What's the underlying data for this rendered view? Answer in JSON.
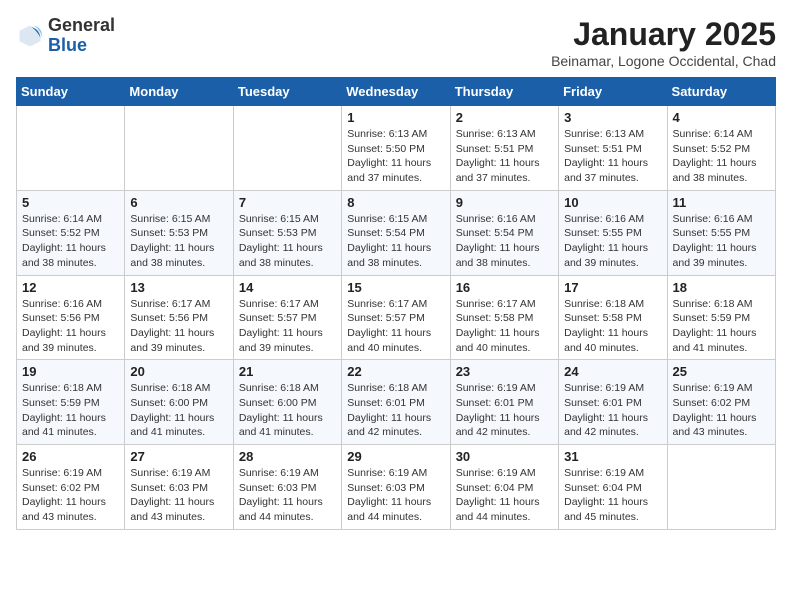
{
  "header": {
    "logo_general": "General",
    "logo_blue": "Blue",
    "month_title": "January 2025",
    "location": "Beinamar, Logone Occidental, Chad"
  },
  "weekdays": [
    "Sunday",
    "Monday",
    "Tuesday",
    "Wednesday",
    "Thursday",
    "Friday",
    "Saturday"
  ],
  "weeks": [
    [
      {
        "day": "",
        "info": ""
      },
      {
        "day": "",
        "info": ""
      },
      {
        "day": "",
        "info": ""
      },
      {
        "day": "1",
        "info": "Sunrise: 6:13 AM\nSunset: 5:50 PM\nDaylight: 11 hours and 37 minutes."
      },
      {
        "day": "2",
        "info": "Sunrise: 6:13 AM\nSunset: 5:51 PM\nDaylight: 11 hours and 37 minutes."
      },
      {
        "day": "3",
        "info": "Sunrise: 6:13 AM\nSunset: 5:51 PM\nDaylight: 11 hours and 37 minutes."
      },
      {
        "day": "4",
        "info": "Sunrise: 6:14 AM\nSunset: 5:52 PM\nDaylight: 11 hours and 38 minutes."
      }
    ],
    [
      {
        "day": "5",
        "info": "Sunrise: 6:14 AM\nSunset: 5:52 PM\nDaylight: 11 hours and 38 minutes."
      },
      {
        "day": "6",
        "info": "Sunrise: 6:15 AM\nSunset: 5:53 PM\nDaylight: 11 hours and 38 minutes."
      },
      {
        "day": "7",
        "info": "Sunrise: 6:15 AM\nSunset: 5:53 PM\nDaylight: 11 hours and 38 minutes."
      },
      {
        "day": "8",
        "info": "Sunrise: 6:15 AM\nSunset: 5:54 PM\nDaylight: 11 hours and 38 minutes."
      },
      {
        "day": "9",
        "info": "Sunrise: 6:16 AM\nSunset: 5:54 PM\nDaylight: 11 hours and 38 minutes."
      },
      {
        "day": "10",
        "info": "Sunrise: 6:16 AM\nSunset: 5:55 PM\nDaylight: 11 hours and 39 minutes."
      },
      {
        "day": "11",
        "info": "Sunrise: 6:16 AM\nSunset: 5:55 PM\nDaylight: 11 hours and 39 minutes."
      }
    ],
    [
      {
        "day": "12",
        "info": "Sunrise: 6:16 AM\nSunset: 5:56 PM\nDaylight: 11 hours and 39 minutes."
      },
      {
        "day": "13",
        "info": "Sunrise: 6:17 AM\nSunset: 5:56 PM\nDaylight: 11 hours and 39 minutes."
      },
      {
        "day": "14",
        "info": "Sunrise: 6:17 AM\nSunset: 5:57 PM\nDaylight: 11 hours and 39 minutes."
      },
      {
        "day": "15",
        "info": "Sunrise: 6:17 AM\nSunset: 5:57 PM\nDaylight: 11 hours and 40 minutes."
      },
      {
        "day": "16",
        "info": "Sunrise: 6:17 AM\nSunset: 5:58 PM\nDaylight: 11 hours and 40 minutes."
      },
      {
        "day": "17",
        "info": "Sunrise: 6:18 AM\nSunset: 5:58 PM\nDaylight: 11 hours and 40 minutes."
      },
      {
        "day": "18",
        "info": "Sunrise: 6:18 AM\nSunset: 5:59 PM\nDaylight: 11 hours and 41 minutes."
      }
    ],
    [
      {
        "day": "19",
        "info": "Sunrise: 6:18 AM\nSunset: 5:59 PM\nDaylight: 11 hours and 41 minutes."
      },
      {
        "day": "20",
        "info": "Sunrise: 6:18 AM\nSunset: 6:00 PM\nDaylight: 11 hours and 41 minutes."
      },
      {
        "day": "21",
        "info": "Sunrise: 6:18 AM\nSunset: 6:00 PM\nDaylight: 11 hours and 41 minutes."
      },
      {
        "day": "22",
        "info": "Sunrise: 6:18 AM\nSunset: 6:01 PM\nDaylight: 11 hours and 42 minutes."
      },
      {
        "day": "23",
        "info": "Sunrise: 6:19 AM\nSunset: 6:01 PM\nDaylight: 11 hours and 42 minutes."
      },
      {
        "day": "24",
        "info": "Sunrise: 6:19 AM\nSunset: 6:01 PM\nDaylight: 11 hours and 42 minutes."
      },
      {
        "day": "25",
        "info": "Sunrise: 6:19 AM\nSunset: 6:02 PM\nDaylight: 11 hours and 43 minutes."
      }
    ],
    [
      {
        "day": "26",
        "info": "Sunrise: 6:19 AM\nSunset: 6:02 PM\nDaylight: 11 hours and 43 minutes."
      },
      {
        "day": "27",
        "info": "Sunrise: 6:19 AM\nSunset: 6:03 PM\nDaylight: 11 hours and 43 minutes."
      },
      {
        "day": "28",
        "info": "Sunrise: 6:19 AM\nSunset: 6:03 PM\nDaylight: 11 hours and 44 minutes."
      },
      {
        "day": "29",
        "info": "Sunrise: 6:19 AM\nSunset: 6:03 PM\nDaylight: 11 hours and 44 minutes."
      },
      {
        "day": "30",
        "info": "Sunrise: 6:19 AM\nSunset: 6:04 PM\nDaylight: 11 hours and 44 minutes."
      },
      {
        "day": "31",
        "info": "Sunrise: 6:19 AM\nSunset: 6:04 PM\nDaylight: 11 hours and 45 minutes."
      },
      {
        "day": "",
        "info": ""
      }
    ]
  ]
}
